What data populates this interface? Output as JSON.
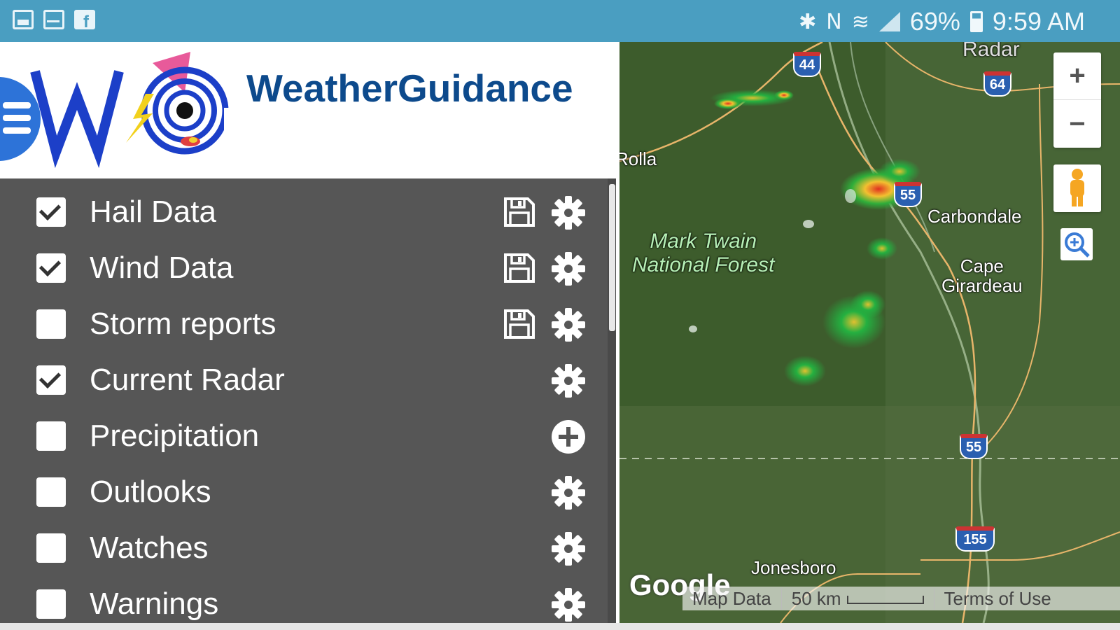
{
  "status_bar": {
    "battery": "69%",
    "time": "9:59 AM"
  },
  "header": {
    "brand": "WeatherGuidance"
  },
  "layers": [
    {
      "label": "Hail Data",
      "checked": true,
      "has_save": true,
      "action_icon": "gear-icon"
    },
    {
      "label": "Wind Data",
      "checked": true,
      "has_save": true,
      "action_icon": "gear-icon"
    },
    {
      "label": "Storm reports",
      "checked": false,
      "has_save": true,
      "action_icon": "gear-icon"
    },
    {
      "label": "Current Radar",
      "checked": true,
      "has_save": false,
      "action_icon": "gear-icon"
    },
    {
      "label": "Precipitation",
      "checked": false,
      "has_save": false,
      "action_icon": "plus-circle-icon"
    },
    {
      "label": "Outlooks",
      "checked": false,
      "has_save": false,
      "action_icon": "gear-icon"
    },
    {
      "label": "Watches",
      "checked": false,
      "has_save": false,
      "action_icon": "gear-icon"
    },
    {
      "label": "Warnings",
      "checked": false,
      "has_save": false,
      "action_icon": "gear-icon"
    }
  ],
  "map": {
    "zoom_in": "+",
    "zoom_out": "−",
    "labels": {
      "radar": "Radar",
      "rolla": "Rolla",
      "forest": "Mark Twain\nNational Forest",
      "carbondale": "Carbondale",
      "cape_girardeau": "Cape\nGirardeau",
      "jonesboro": "Jonesboro"
    },
    "shields": [
      "44",
      "64",
      "55",
      "55",
      "155"
    ],
    "google": "Google",
    "map_data": "Map Data",
    "scale": "50 km",
    "terms": "Terms of Use"
  },
  "colors": {
    "status_bar": "#4a9ec1",
    "panel": "#565656",
    "brand": "#0d4a8c",
    "menu_button": "#2d73d8"
  }
}
